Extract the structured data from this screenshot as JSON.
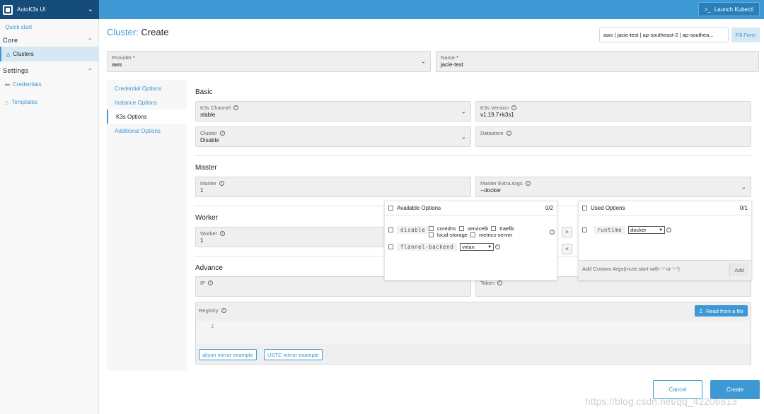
{
  "app": {
    "title": "AutoK3s UI",
    "launch_label": "Launch Kubectl",
    "launch_icon": ">_"
  },
  "sidebar": {
    "quick_start": "Quick start",
    "groups": [
      {
        "label": "Core",
        "items": [
          {
            "label": "Clusters",
            "icon": "cluster-icon"
          }
        ]
      },
      {
        "label": "Settings",
        "items": [
          {
            "label": "Credentials",
            "icon": "folder-icon"
          },
          {
            "label": "Templates",
            "icon": "template-icon"
          }
        ]
      }
    ]
  },
  "page": {
    "crumb": "Cluster:",
    "title": "Create",
    "summary": "aws | jacie-test | ap-southeast-2 | ap-southea...",
    "fill_form": "Fill Form"
  },
  "provider": {
    "label": "Provider",
    "value": "aws"
  },
  "name": {
    "label": "Name",
    "value": "jacie-test"
  },
  "tabs": [
    "Credential Options",
    "Instance Options",
    "K3s Options",
    "Additional Options"
  ],
  "basic": {
    "title": "Basic",
    "k3s_channel": {
      "label": "K3s Channel",
      "value": "stable"
    },
    "k3s_version": {
      "label": "K3s Version",
      "value": "v1.19.7+k3s1"
    },
    "cluster": {
      "label": "Cluster",
      "value": "Disable"
    },
    "datastore": {
      "label": "Datastore",
      "value": ""
    }
  },
  "master": {
    "title": "Master",
    "master": {
      "label": "Master",
      "value": "1"
    },
    "extra_args": {
      "label": "Master Extra Args",
      "value": "--docker"
    }
  },
  "worker": {
    "title": "Worker",
    "worker": {
      "label": "Worker",
      "value": "1"
    }
  },
  "advance": {
    "title": "Advance",
    "ip": {
      "label": "IP"
    },
    "token": {
      "label": "Token"
    },
    "registry": {
      "label": "Registry",
      "read_file": "Read from a file",
      "line_no": "1"
    },
    "mirror_aliyun": "aliyun mirror example",
    "mirror_ustc": "USTC mirror example"
  },
  "transfer": {
    "available": {
      "title": "Available Options",
      "count": "0/2"
    },
    "used": {
      "title": "Used Options",
      "count": "0/1"
    },
    "disable": {
      "name": "disable",
      "options": [
        "coredns",
        "servicelb",
        "traefik",
        "local-storage",
        "metrics-server"
      ]
    },
    "flannel": {
      "name": "flannel-backend",
      "value": "vxlan"
    },
    "runtime": {
      "name": "runtime",
      "value": "docker"
    },
    "custom_placeholder": "Add Custom Args(must start with '-' or '--')",
    "add": "Add",
    "to_right": ">",
    "to_left": "<"
  },
  "actions": {
    "cancel": "Cancel",
    "create": "Create"
  },
  "watermark": "https://blog.csdn.net/qq_42206813"
}
